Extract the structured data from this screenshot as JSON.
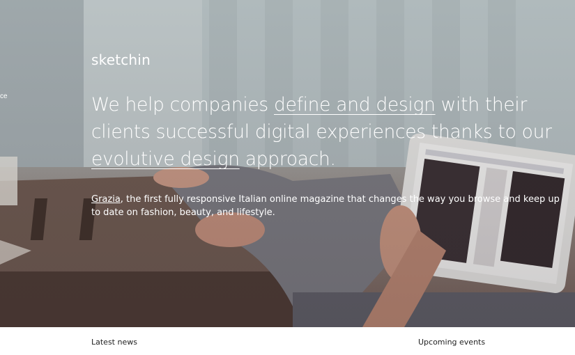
{
  "header": {
    "logo": "sketchin"
  },
  "side_fragment": "ce",
  "hero": {
    "headline": {
      "part1": "We help companies ",
      "link1": "define and design",
      "part2": " with their clients successful digital experiences thanks to our ",
      "link2": "evolutive design",
      "part3": " approach."
    },
    "caption": {
      "link": "Grazia",
      "text": ", the first fully responsive Italian online magazine that changes the way you browse and keep up to date on fashion, beauty, and lifestyle."
    }
  },
  "sections": {
    "latest_news": "Latest news",
    "upcoming_events": "Upcoming events"
  }
}
